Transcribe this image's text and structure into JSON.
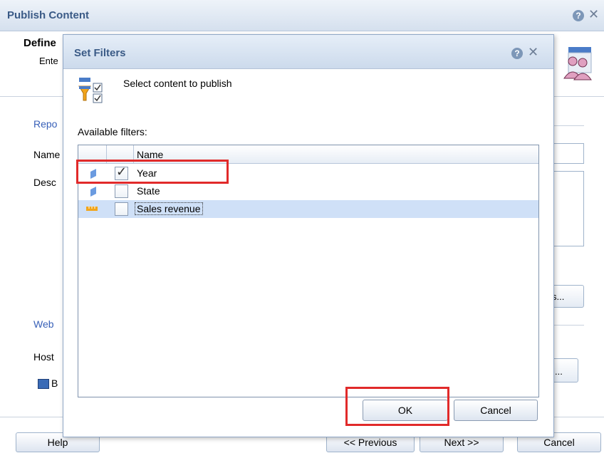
{
  "outer": {
    "title": "Publish Content",
    "section_title": "Define",
    "enter_text": "Ente",
    "labels": {
      "report": "Repo",
      "name": "Name",
      "desc": "Desc",
      "web": "Web",
      "host": "Host",
      "browse_fragment": "B"
    },
    "right_button_1": "s...",
    "right_button_2": "...",
    "buttons": {
      "help": "Help",
      "previous": "<< Previous",
      "next": "Next >>",
      "cancel": "Cancel"
    }
  },
  "dialog": {
    "title": "Set Filters",
    "instruction": "Select content to publish",
    "available_label": "Available filters:",
    "column_name": "Name",
    "filters": [
      {
        "label": "Year",
        "checked": true,
        "icon": "dimension-icon",
        "selected": false
      },
      {
        "label": "State",
        "checked": false,
        "icon": "dimension-icon",
        "selected": false
      },
      {
        "label": "Sales revenue",
        "checked": false,
        "icon": "measure-icon",
        "selected": true
      }
    ],
    "ok_label": "OK",
    "cancel_label": "Cancel"
  },
  "colors": {
    "title_text": "#3a5a86",
    "accent_blue_label": "#3860b8",
    "highlight_red": "#e12a2a",
    "selected_row": "#cfe0f7"
  }
}
